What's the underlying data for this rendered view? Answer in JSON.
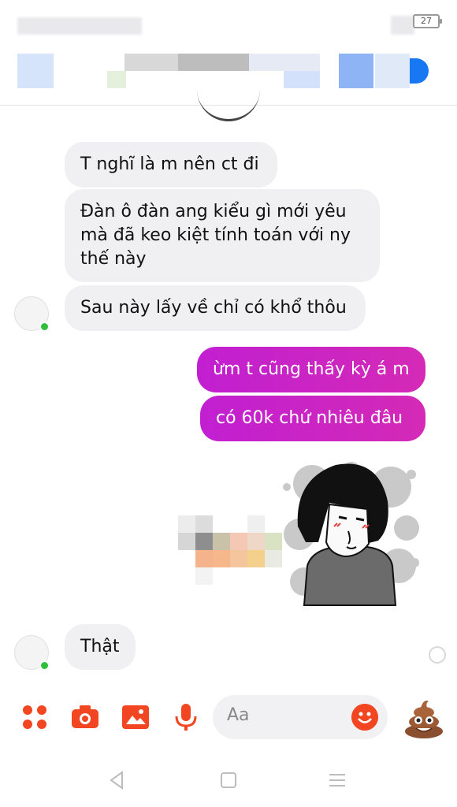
{
  "status_bar": {
    "battery": "27"
  },
  "messages": [
    {
      "id": "m1",
      "side": "incoming",
      "text": "T nghĩ là m nên ct đi"
    },
    {
      "id": "m2",
      "side": "incoming",
      "text": "Đàn ô đàn ang kiểu gì mới yêu mà đã keo kiệt tính toán với ny thế này"
    },
    {
      "id": "m3",
      "side": "incoming",
      "text": "Sau này lấy về chỉ có khổ thôu"
    },
    {
      "id": "m4",
      "side": "outgoing",
      "text": "ừm t cũng thấy kỳ á m"
    },
    {
      "id": "m5",
      "side": "outgoing",
      "text": "có 60k chứ nhiêu đâu"
    },
    {
      "id": "m6",
      "side": "incoming",
      "text": "Thật"
    }
  ],
  "composer": {
    "placeholder": "Aa",
    "icons": [
      "apps-icon",
      "camera-icon",
      "gallery-icon",
      "microphone-icon",
      "emoji-icon",
      "poo-emoji-icon"
    ]
  },
  "nav_bar": {
    "icons": [
      "back-icon",
      "home-icon",
      "recents-icon"
    ]
  },
  "colors": {
    "accent": "#f24622",
    "outgoing_bubble_start": "#c11fd1",
    "outgoing_bubble_end": "#d42ab6",
    "incoming_bubble": "#f0f0f2",
    "online": "#2fbf3c"
  }
}
